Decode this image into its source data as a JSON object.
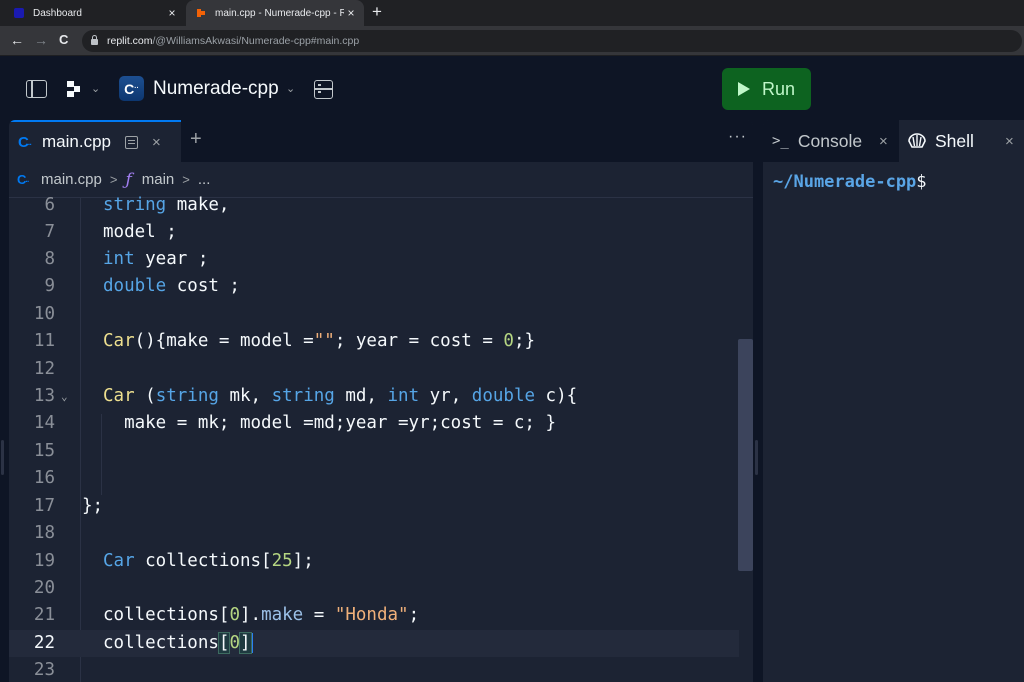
{
  "browser": {
    "tabs": [
      {
        "title": "Dashboard",
        "active": false
      },
      {
        "title": "main.cpp - Numerade-cpp - Replit",
        "active": true
      }
    ],
    "close_glyph": "×",
    "new_tab_glyph": "+",
    "nav": {
      "back": "←",
      "forward": "→",
      "reload": "C"
    },
    "url": {
      "host": "replit.com",
      "path": "/@WilliamsAkwasi/Numerade-cpp#main.cpp"
    }
  },
  "header": {
    "project_name": "Numerade-cpp",
    "project_icon": "C",
    "chevron": "⌄",
    "run_label": "Run",
    "run_color": "#0d6320"
  },
  "editor": {
    "tab": {
      "filename": "main.cpp",
      "close": "×"
    },
    "add_tab": "+",
    "more": "···",
    "breadcrumb": {
      "file": "main.cpp",
      "function": "main",
      "sep": ">",
      "ellipsis": "...",
      "fn_glyph": "ƒ"
    },
    "lines": [
      {
        "n": "6"
      },
      {
        "n": "7"
      },
      {
        "n": "8"
      },
      {
        "n": "9"
      },
      {
        "n": "10"
      },
      {
        "n": "11"
      },
      {
        "n": "12"
      },
      {
        "n": "13"
      },
      {
        "n": "14"
      },
      {
        "n": "15"
      },
      {
        "n": "16"
      },
      {
        "n": "17"
      },
      {
        "n": "18"
      },
      {
        "n": "19"
      },
      {
        "n": "20"
      },
      {
        "n": "21"
      },
      {
        "n": "22"
      },
      {
        "n": "23"
      }
    ],
    "code": {
      "l6": {
        "kw": "string",
        "rest": " make,"
      },
      "l7": {
        "rest": "model ;"
      },
      "l8": {
        "kw": "int",
        "rest": " year ;"
      },
      "l9": {
        "kw": "double",
        "rest": " cost ;"
      },
      "l11": {
        "ty": "Car",
        "a": "(){make = model =",
        "str": "\"\"",
        "b": "; year = cost = ",
        "num": "0",
        "c": ";}"
      },
      "l13": {
        "ty": "Car",
        "a": " (",
        "k1": "string",
        "b": " mk, ",
        "k2": "string",
        "c": " md, ",
        "k3": "int",
        "d": " yr, ",
        "k4": "double",
        "e": " c){"
      },
      "l14": {
        "rest": "  make = mk; model =md;year =yr;cost = c; }"
      },
      "l17": {
        "rest": "};"
      },
      "l19": {
        "kw": "Car",
        "a": " collections[",
        "num": "25",
        "b": "];"
      },
      "l21": {
        "a": "collections[",
        "num": "0",
        "b": "].",
        "prop": "make",
        "c": " = ",
        "str": "\"Honda\"",
        "d": ";"
      },
      "l22": {
        "a": "collections",
        "b1": "[",
        "num": "0",
        "b2": "]"
      }
    },
    "fold_glyph": "⌄"
  },
  "right_panel": {
    "tabs": [
      {
        "label": "Console",
        "icon": ">_",
        "active": false
      },
      {
        "label": "Shell",
        "active": true
      }
    ],
    "close": "×",
    "prompt_path": "~/Numerade-cpp",
    "prompt_symbol": "$"
  }
}
